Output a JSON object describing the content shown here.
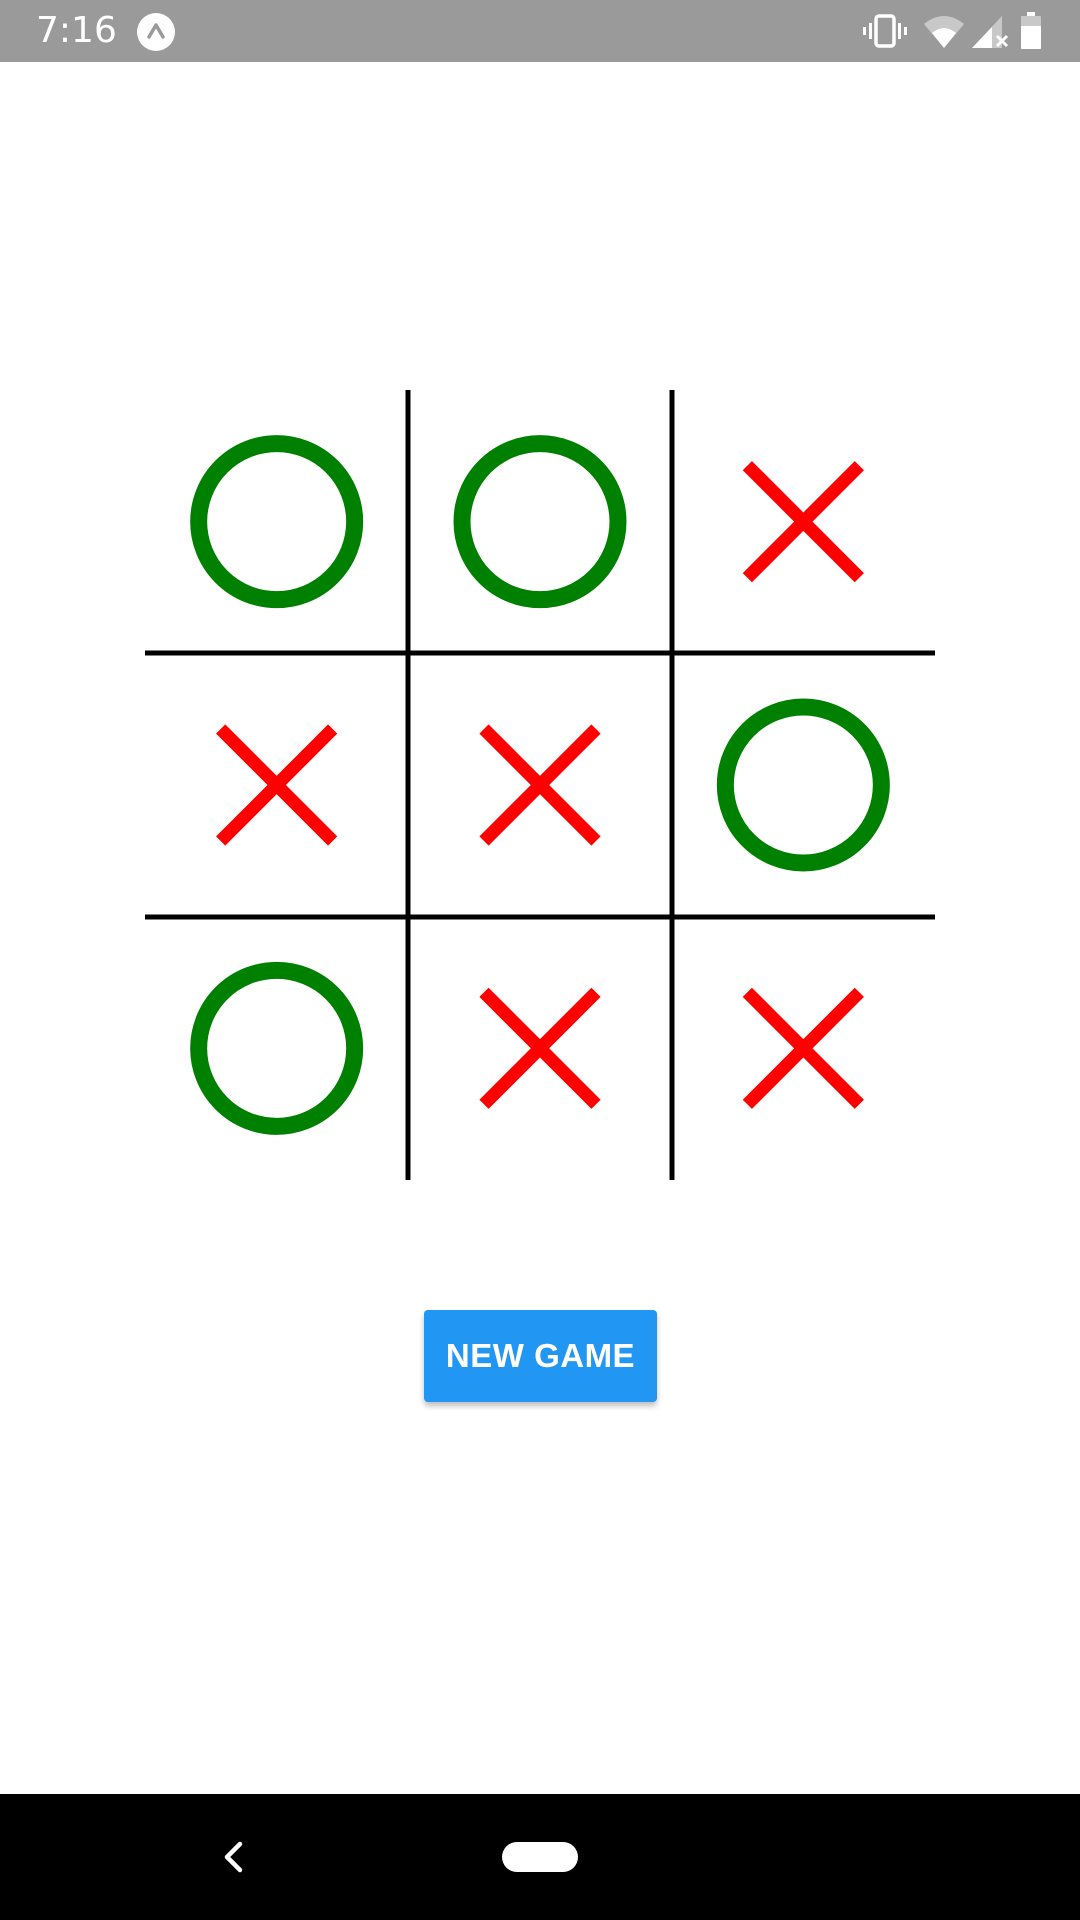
{
  "status_bar": {
    "time": "7:16",
    "icons": [
      "app-notification-icon",
      "vibrate-icon",
      "wifi-icon",
      "cellular-signal-icon",
      "battery-icon"
    ]
  },
  "board": {
    "cells": [
      [
        "O",
        "O",
        "X"
      ],
      [
        "X",
        "X",
        "O"
      ],
      [
        "O",
        "X",
        "X"
      ]
    ],
    "colors": {
      "x": "#ff0000",
      "o": "#008000",
      "grid": "#000000"
    }
  },
  "new_game_button": {
    "label": "NEW GAME",
    "color": "#2196f3"
  },
  "nav_bar": {
    "icons": [
      "back-icon",
      "home-pill-icon"
    ]
  }
}
